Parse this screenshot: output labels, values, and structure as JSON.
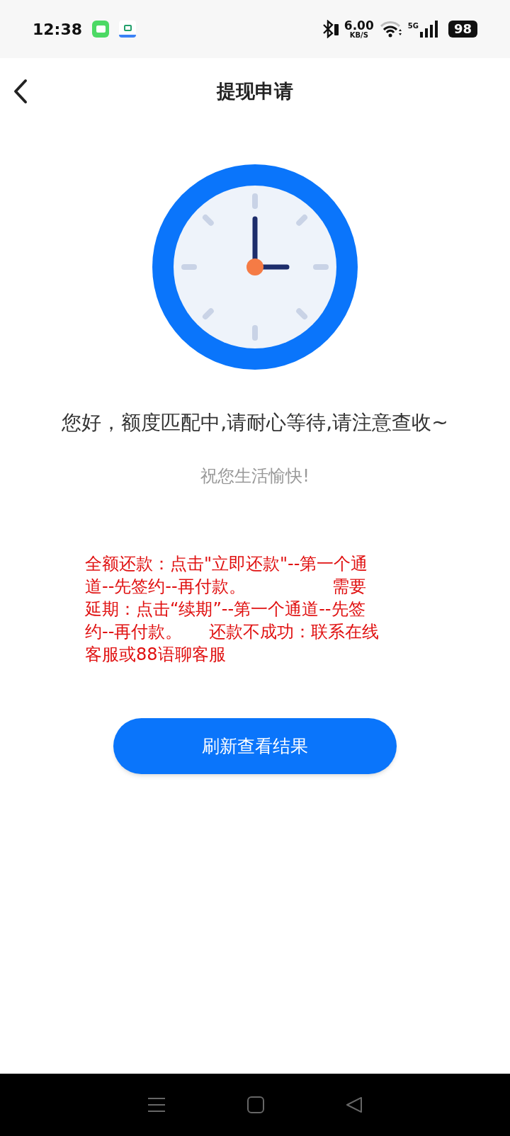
{
  "status_bar": {
    "time": "12:38",
    "speed": "6.00",
    "speed_unit": "KB/S",
    "network": "5G",
    "battery": "98"
  },
  "header": {
    "title": "提现申请"
  },
  "message": "您好，额度匹配中,请耐心等待,请注意查收~",
  "wish": "祝您生活愉快!",
  "notice_lines": [
    "全额还款：点击\"立即还款\"--第一个通",
    "道--先签约--再付款。                需要",
    "延期：点击“续期”--第一个通道--先签",
    "约--再付款。     还款不成功：联系在线",
    "客服或88语聊客服"
  ],
  "button": "刷新查看结果"
}
